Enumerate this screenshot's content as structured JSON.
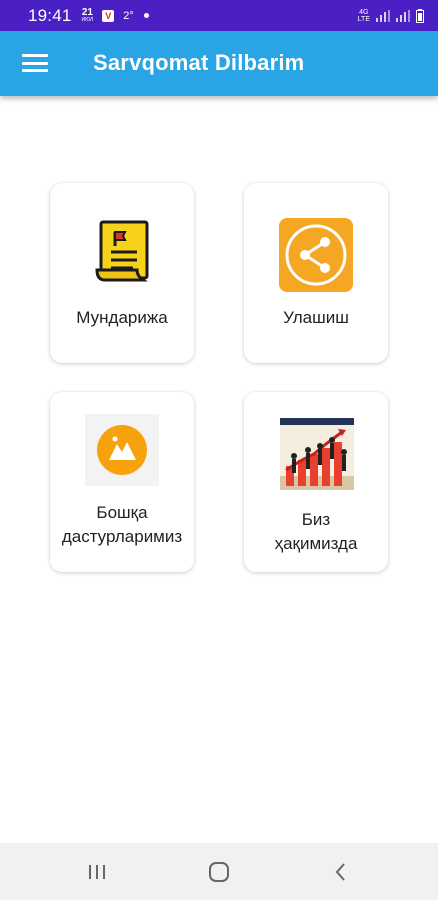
{
  "status_bar": {
    "time": "19:41",
    "date_day": "21",
    "date_month": "ИЮЛ",
    "notification_badge": "V",
    "temperature": "2°",
    "network_label_top": "4G",
    "network_label_bottom": "LTE"
  },
  "app_bar": {
    "title": "Sarvqomat Dilbarim",
    "menu_icon": "hamburger-menu-icon"
  },
  "menu": [
    {
      "id": "contents",
      "label": "Мундарижа",
      "icon": "document-flag-icon",
      "accent": "#f7d21b"
    },
    {
      "id": "share",
      "label": "Улашиш",
      "icon": "share-icon",
      "accent": "#f5a623"
    },
    {
      "id": "other-apps",
      "label_line1": "Бошқа",
      "label_line2": "дастурларимиз",
      "icon": "mountains-icon",
      "accent": "#f5a20c"
    },
    {
      "id": "about",
      "label_line1": "Биз",
      "label_line2": "ҳақимизда",
      "icon": "team-growth-photo-icon",
      "accent": "#e8402f"
    }
  ],
  "nav_bar": {
    "recents_icon": "recent-apps-icon",
    "home_icon": "home-icon",
    "back_icon": "back-icon"
  },
  "colors": {
    "status_bar": "#4a20c4",
    "app_bar": "#29a4e4",
    "background": "#ffffff"
  }
}
